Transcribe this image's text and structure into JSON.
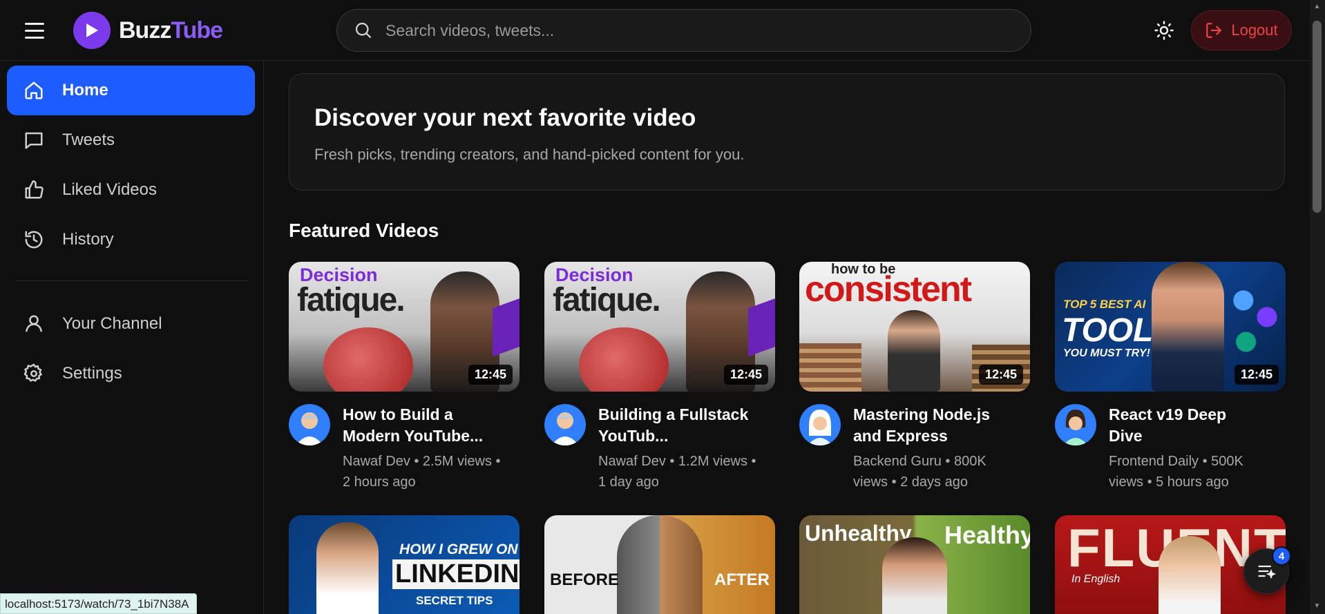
{
  "header": {
    "logo_primary": "Buzz",
    "logo_secondary": "Tube",
    "search_placeholder": "Search videos, tweets...",
    "logout_label": "Logout"
  },
  "sidebar": {
    "items": [
      {
        "label": "Home",
        "icon": "home-icon",
        "active": true
      },
      {
        "label": "Tweets",
        "icon": "message-icon"
      },
      {
        "label": "Liked Videos",
        "icon": "thumbs-up-icon"
      },
      {
        "label": "History",
        "icon": "history-icon"
      },
      {
        "label": "Your Channel",
        "icon": "user-icon"
      },
      {
        "label": "Settings",
        "icon": "gear-icon"
      }
    ]
  },
  "hero": {
    "title": "Discover your next favorite video",
    "subtitle": "Fresh picks, trending creators, and hand-picked content for you."
  },
  "featured": {
    "title": "Featured Videos",
    "videos": [
      {
        "title": "How to Build a Modern YouTube...",
        "channel": "Nawaf Dev",
        "meta": "Nawaf Dev • 2.5M views • 2 hours ago",
        "duration": "12:45",
        "thumb_line1": "Decision",
        "thumb_line2": "fatique."
      },
      {
        "title": "Building a Fullstack YouTub...",
        "channel": "Nawaf Dev",
        "meta": "Nawaf Dev • 1.2M views • 1 day ago",
        "duration": "12:45",
        "thumb_line1": "Decision",
        "thumb_line2": "fatique."
      },
      {
        "title": "Mastering Node.js and Express",
        "channel": "Backend Guru",
        "meta": "Backend Guru • 800K views • 2 days ago",
        "duration": "12:45",
        "thumb_line1": "how to be",
        "thumb_line2": "consistent"
      },
      {
        "title": "React v19 Deep Dive",
        "channel": "Frontend Daily",
        "meta": "Frontend Daily • 500K views • 5 hours ago",
        "duration": "12:45",
        "thumb_line1": "TOP 5 BEST AI",
        "thumb_line2": "TOOLS",
        "thumb_line3": "YOU MUST TRY!"
      }
    ],
    "row2": [
      {
        "thumb_line1": "HOW I GREW ON",
        "thumb_line2": "LINKEDIN",
        "thumb_line3": "SECRET TIPS"
      },
      {
        "thumb_line1": "BEFORE",
        "thumb_line2": "AFTER"
      },
      {
        "thumb_line1": "Unhealthy",
        "thumb_line2": "Healthy"
      },
      {
        "thumb_line1": "FLUENT",
        "thumb_line2": "In English"
      }
    ]
  },
  "queue": {
    "badge": "4"
  },
  "status_bar": {
    "url": "localhost:5173/watch/73_1bi7N38A"
  },
  "colors": {
    "accent": "#1d5cff",
    "brand": "#8b5cf6",
    "danger": "#ef4444"
  }
}
